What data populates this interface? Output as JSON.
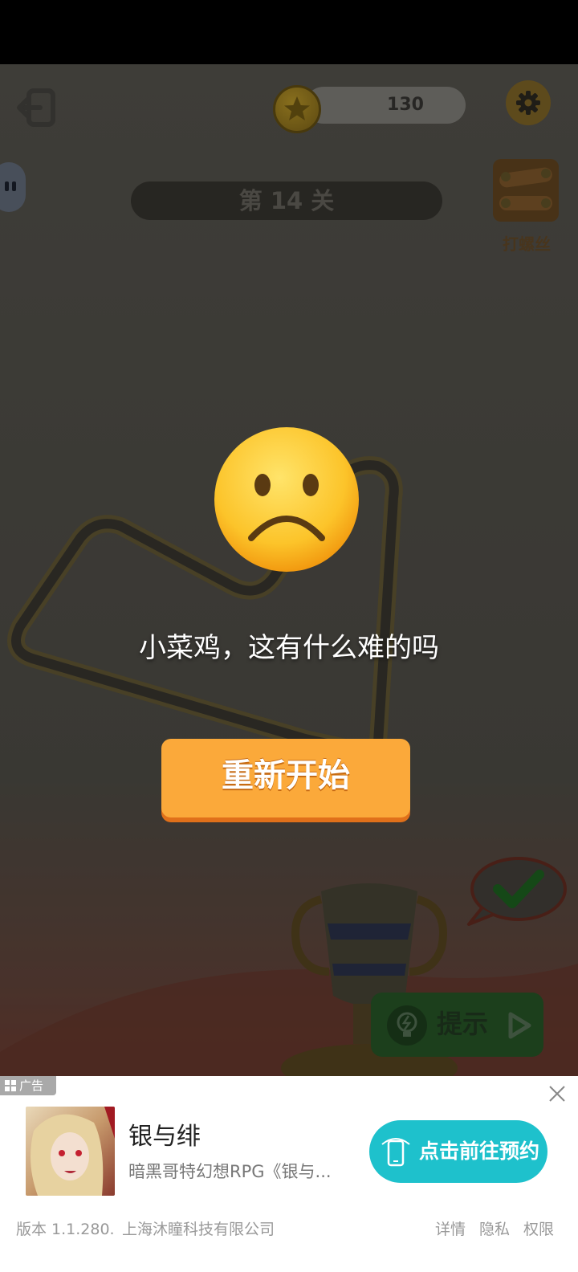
{
  "topbar": {
    "coin_count": "130",
    "icons": {
      "exit": "exit-icon",
      "coin": "star-coin-icon",
      "settings": "gear-icon"
    }
  },
  "level": {
    "label": "第 14 关"
  },
  "side_promo": {
    "label": "打螺丝",
    "icon": "screw-board-icon"
  },
  "dialog": {
    "emoji": "frowning-face",
    "message": "小菜鸡，这有什么难的吗",
    "restart_label": "重新开始"
  },
  "hint": {
    "label": "提示",
    "icons": [
      "lightbulb-icon",
      "play-icon"
    ]
  },
  "ad": {
    "tag": "广告",
    "title": "银与绯",
    "description": "暗黑哥特幻想RPG《银与...",
    "cta_label": "点击前往预约",
    "footer": {
      "version": "版本 1.1.280.",
      "company": "上海沐瞳科技有限公司",
      "links": [
        "详情",
        "隐私",
        "权限"
      ]
    }
  },
  "colors": {
    "restart_button": "#fba93a",
    "cta_button": "#1ec1cc",
    "overlay": "rgba(0,0,0,0.32)"
  }
}
